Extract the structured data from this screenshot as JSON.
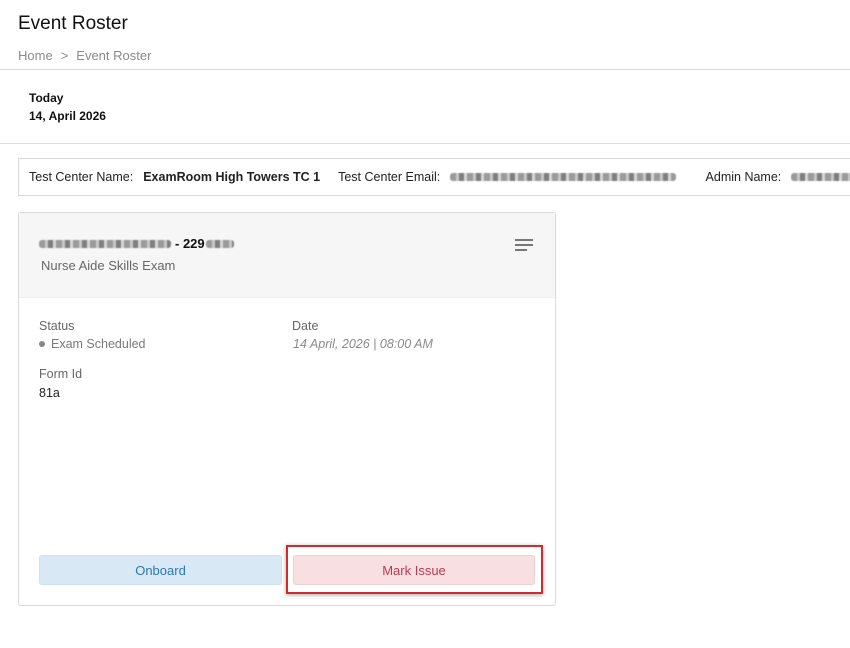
{
  "header": {
    "title": "Event Roster",
    "breadcrumb": {
      "home": "Home",
      "separator": ">",
      "current": "Event Roster"
    }
  },
  "today": {
    "label": "Today",
    "date": "14, April 2026"
  },
  "test_center": {
    "name_label": "Test Center Name:",
    "name_value": "ExamRoom High Towers TC 1",
    "email_label": "Test Center Email:",
    "admin_label": "Admin Name:"
  },
  "card": {
    "candidate_id_suffix": "- 229",
    "exam_name": "Nurse Aide Skills Exam",
    "status_label": "Status",
    "status_value": "Exam Scheduled",
    "date_label": "Date",
    "date_value": "14 April, 2026 | 08:00 AM",
    "form_id_label": "Form Id",
    "form_id_value": "81a",
    "onboard_label": "Onboard",
    "mark_issue_label": "Mark Issue"
  },
  "colors": {
    "onboard_bg": "#d9e8f5",
    "onboard_text": "#2a78b8",
    "issue_bg": "#f7dfe2",
    "issue_text": "#c4384f",
    "highlight_border": "#cf2b2b"
  },
  "icons": {
    "card_menu": "menu-icon"
  }
}
